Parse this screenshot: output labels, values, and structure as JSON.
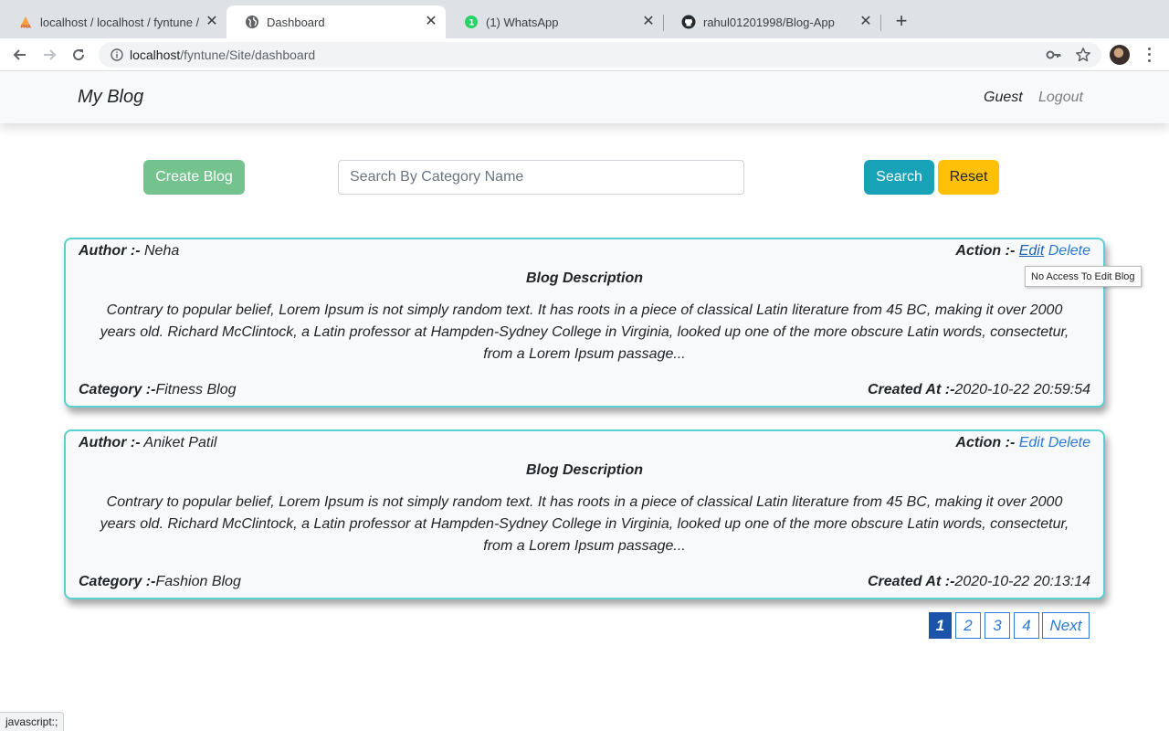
{
  "browser": {
    "tabs": [
      {
        "title": "localhost / localhost / fyntune /",
        "icon": "phpmyadmin-icon",
        "active": false
      },
      {
        "title": "Dashboard",
        "icon": "globe-icon",
        "active": true
      },
      {
        "title": "(1) WhatsApp",
        "icon": "whatsapp-icon",
        "active": false,
        "badge": "1"
      },
      {
        "title": "rahul01201998/Blog-App",
        "icon": "github-icon",
        "active": false
      }
    ],
    "close_glyph": "✕",
    "new_tab_glyph": "+",
    "url_host": "localhost",
    "url_path": "/fyntune/Site/dashboard",
    "status_text": "javascript:;"
  },
  "navbar": {
    "brand": "My Blog",
    "guest": "Guest",
    "logout": "Logout"
  },
  "controls": {
    "create_label": "Create Blog",
    "search_placeholder": "Search By Category Name",
    "search_value": "",
    "search_label": "Search",
    "reset_label": "Reset"
  },
  "labels": {
    "author": "Author :-",
    "action": "Action :-",
    "edit": "Edit",
    "delete": "Delete",
    "desc_title": "Blog Description",
    "category": "Category :-",
    "created": "Created At :-"
  },
  "posts": [
    {
      "author": "Neha",
      "description": "Contrary to popular belief, Lorem Ipsum is not simply random text. It has roots in a piece of classical Latin literature from 45 BC, making it over 2000 years old. Richard McClintock, a Latin professor at Hampden-Sydney College in Virginia, looked up one of the more obscure Latin words, consectetur, from a Lorem Ipsum passage...",
      "category": "Fitness Blog",
      "created_at": "2020-10-22 20:59:54"
    },
    {
      "author": "Aniket Patil",
      "description": "Contrary to popular belief, Lorem Ipsum is not simply random text. It has roots in a piece of classical Latin literature from 45 BC, making it over 2000 years old. Richard McClintock, a Latin professor at Hampden-Sydney College in Virginia, looked up one of the more obscure Latin words, consectetur, from a Lorem Ipsum passage...",
      "category": "Fashion Blog",
      "created_at": "2020-10-22 20:13:14"
    }
  ],
  "tooltip": "No Access To Edit Blog",
  "pagination": {
    "pages": [
      "1",
      "2",
      "3",
      "4"
    ],
    "current": "1",
    "next": "Next"
  },
  "colors": {
    "card_border": "#5bd0d0",
    "link": "#2a7ad6",
    "create_btn": "#74c28e",
    "search_btn": "#17a2b8",
    "reset_btn": "#ffc107",
    "page_active": "#1b54a8"
  }
}
